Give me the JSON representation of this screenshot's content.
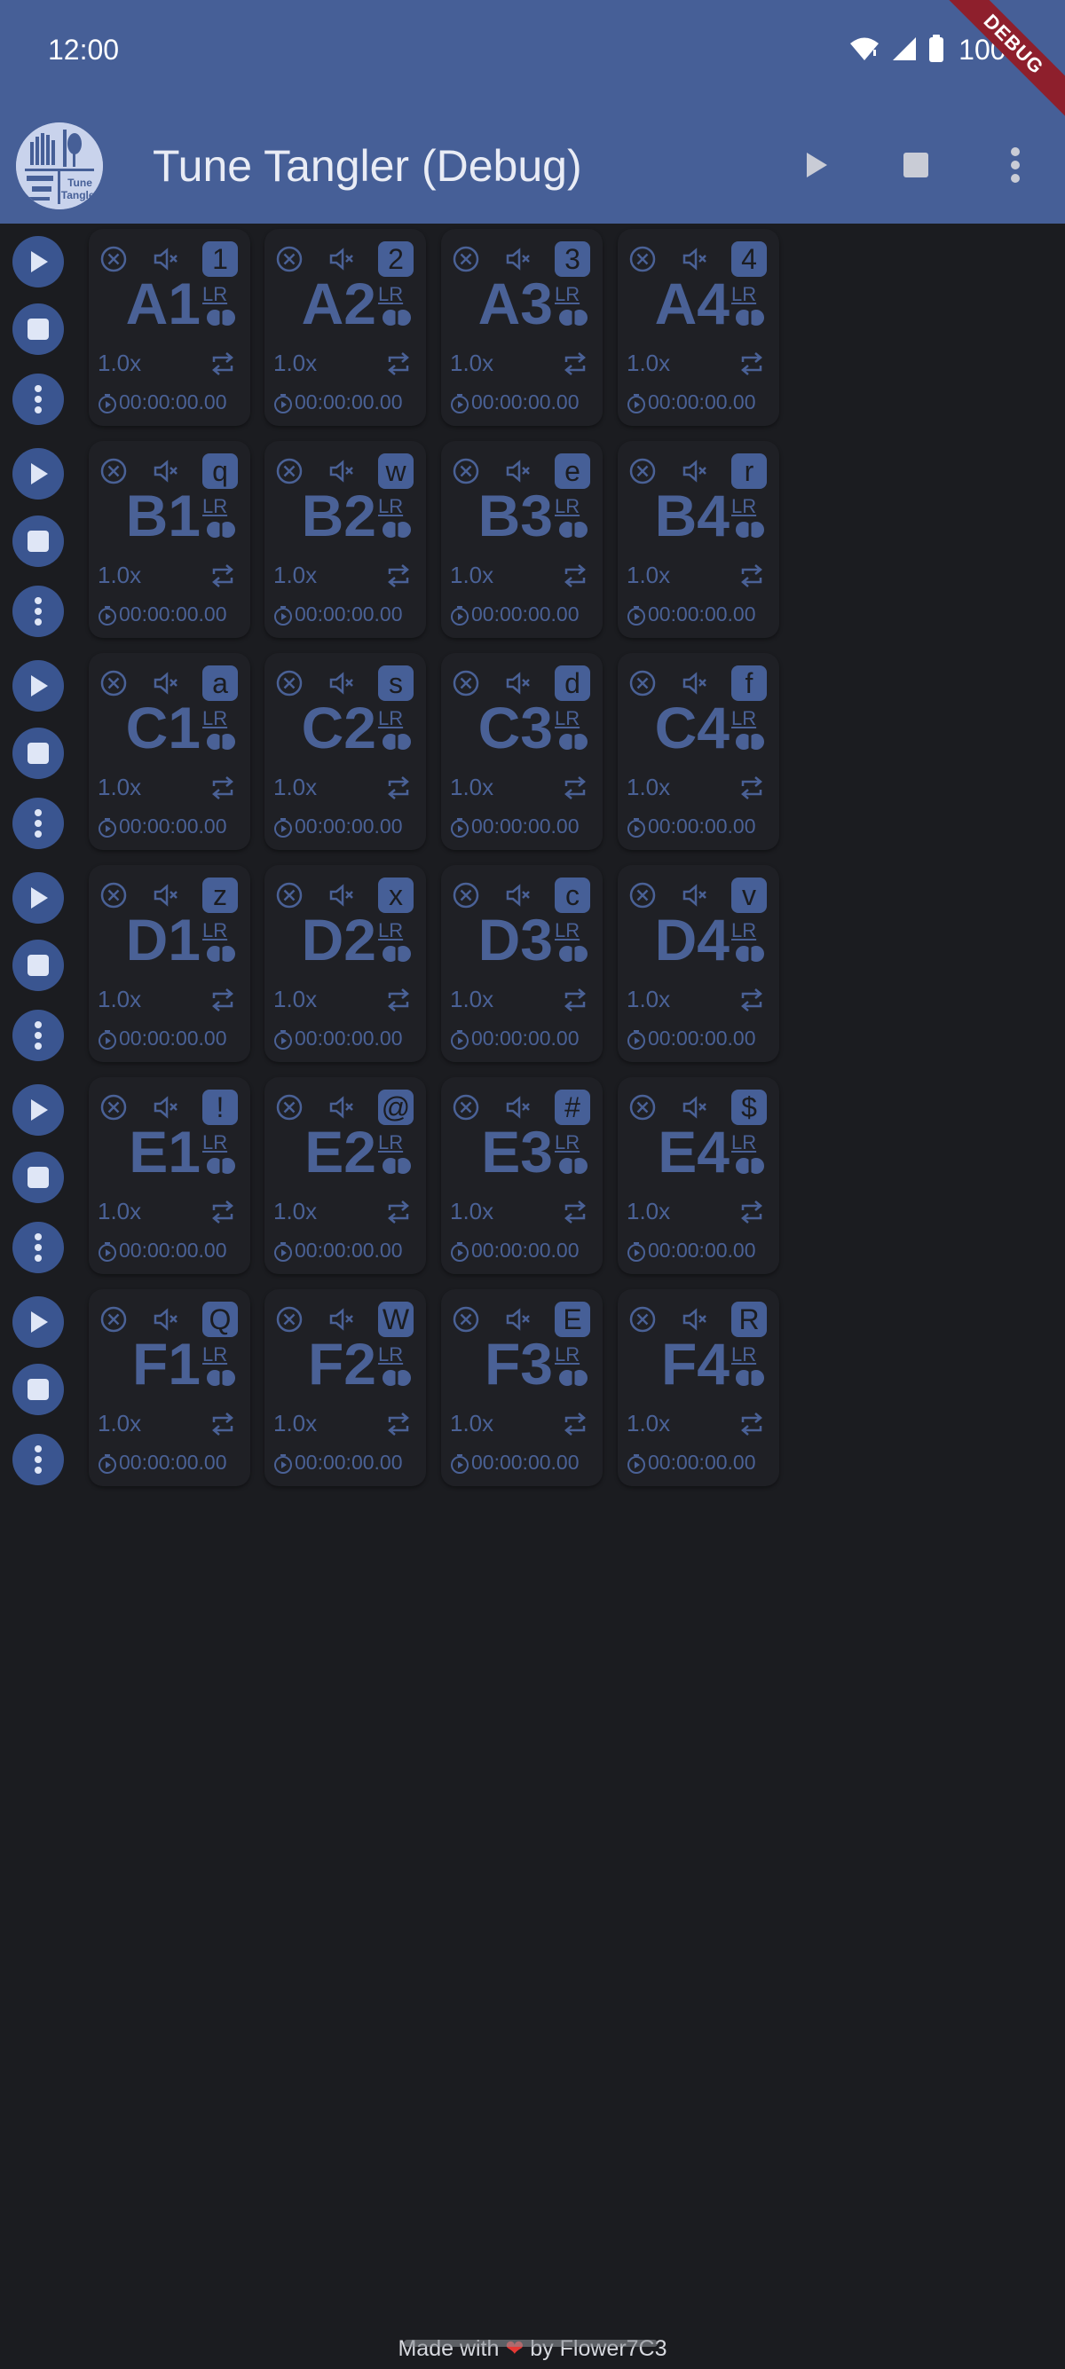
{
  "status_bar": {
    "time": "12:00",
    "battery": "100%"
  },
  "debug_banner": "DEBUG",
  "app_bar": {
    "title": "Tune Tangler (Debug)",
    "logo_text": "Tune Tangler",
    "actions": [
      "play-icon",
      "stop-icon",
      "more-vert-icon"
    ]
  },
  "rows": [
    {
      "tiles": [
        {
          "name": "A1",
          "key": "1",
          "speed": "1.0x",
          "time": "00:00:00.00",
          "channels": "LR"
        },
        {
          "name": "A2",
          "key": "2",
          "speed": "1.0x",
          "time": "00:00:00.00",
          "channels": "LR"
        },
        {
          "name": "A3",
          "key": "3",
          "speed": "1.0x",
          "time": "00:00:00.00",
          "channels": "LR"
        },
        {
          "name": "A4",
          "key": "4",
          "speed": "1.0x",
          "time": "00:00:00.00",
          "channels": "LR"
        }
      ]
    },
    {
      "tiles": [
        {
          "name": "B1",
          "key": "q",
          "speed": "1.0x",
          "time": "00:00:00.00",
          "channels": "LR"
        },
        {
          "name": "B2",
          "key": "w",
          "speed": "1.0x",
          "time": "00:00:00.00",
          "channels": "LR"
        },
        {
          "name": "B3",
          "key": "e",
          "speed": "1.0x",
          "time": "00:00:00.00",
          "channels": "LR"
        },
        {
          "name": "B4",
          "key": "r",
          "speed": "1.0x",
          "time": "00:00:00.00",
          "channels": "LR"
        }
      ]
    },
    {
      "tiles": [
        {
          "name": "C1",
          "key": "a",
          "speed": "1.0x",
          "time": "00:00:00.00",
          "channels": "LR"
        },
        {
          "name": "C2",
          "key": "s",
          "speed": "1.0x",
          "time": "00:00:00.00",
          "channels": "LR"
        },
        {
          "name": "C3",
          "key": "d",
          "speed": "1.0x",
          "time": "00:00:00.00",
          "channels": "LR"
        },
        {
          "name": "C4",
          "key": "f",
          "speed": "1.0x",
          "time": "00:00:00.00",
          "channels": "LR"
        }
      ]
    },
    {
      "tiles": [
        {
          "name": "D1",
          "key": "z",
          "speed": "1.0x",
          "time": "00:00:00.00",
          "channels": "LR"
        },
        {
          "name": "D2",
          "key": "x",
          "speed": "1.0x",
          "time": "00:00:00.00",
          "channels": "LR"
        },
        {
          "name": "D3",
          "key": "c",
          "speed": "1.0x",
          "time": "00:00:00.00",
          "channels": "LR"
        },
        {
          "name": "D4",
          "key": "v",
          "speed": "1.0x",
          "time": "00:00:00.00",
          "channels": "LR"
        }
      ]
    },
    {
      "tiles": [
        {
          "name": "E1",
          "key": "!",
          "speed": "1.0x",
          "time": "00:00:00.00",
          "channels": "LR"
        },
        {
          "name": "E2",
          "key": "@",
          "speed": "1.0x",
          "time": "00:00:00.00",
          "channels": "LR"
        },
        {
          "name": "E3",
          "key": "#",
          "speed": "1.0x",
          "time": "00:00:00.00",
          "channels": "LR"
        },
        {
          "name": "E4",
          "key": "$",
          "speed": "1.0x",
          "time": "00:00:00.00",
          "channels": "LR"
        }
      ]
    },
    {
      "tiles": [
        {
          "name": "F1",
          "key": "Q",
          "speed": "1.0x",
          "time": "00:00:00.00",
          "channels": "LR"
        },
        {
          "name": "F2",
          "key": "W",
          "speed": "1.0x",
          "time": "00:00:00.00",
          "channels": "LR"
        },
        {
          "name": "F3",
          "key": "E",
          "speed": "1.0x",
          "time": "00:00:00.00",
          "channels": "LR"
        },
        {
          "name": "F4",
          "key": "R",
          "speed": "1.0x",
          "time": "00:00:00.00",
          "channels": "LR"
        }
      ]
    }
  ],
  "footer": {
    "prefix": "Made with",
    "suffix": "by Flower7C3"
  },
  "colors": {
    "app_bar": "#465f97",
    "background": "#1b1c20",
    "tile": "#1f2025",
    "accent": "#4a6196",
    "heart": "#e53935"
  }
}
